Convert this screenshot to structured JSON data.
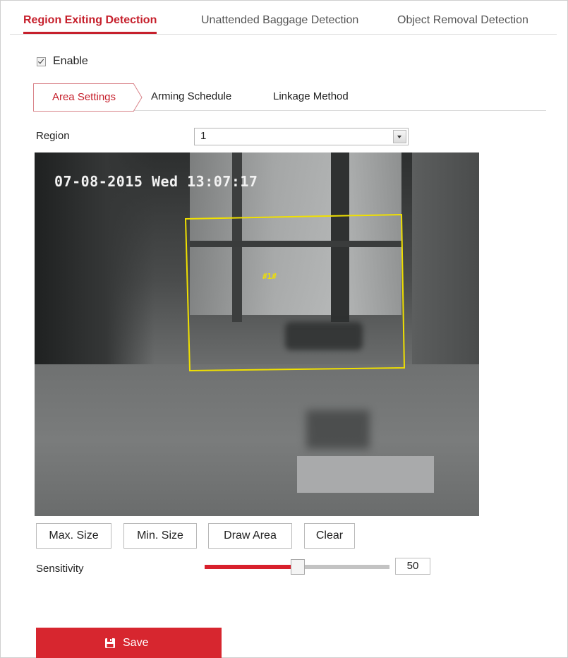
{
  "top_tabs": [
    "Region Exiting Detection",
    "Unattended Baggage Detection",
    "Object Removal Detection"
  ],
  "enable": {
    "label": "Enable",
    "checked": true
  },
  "sub_tabs": [
    "Area Settings",
    "Arming Schedule",
    "Linkage Method"
  ],
  "region": {
    "label": "Region",
    "value": "1"
  },
  "video": {
    "osd_datetime": "07-08-2015 Wed 13:07:17",
    "region_label": "#1#"
  },
  "buttons": {
    "max_size": "Max. Size",
    "min_size": "Min. Size",
    "draw_area": "Draw Area",
    "clear": "Clear"
  },
  "sensitivity": {
    "label": "Sensitivity",
    "value": "50",
    "fraction": 0.5
  },
  "save": {
    "label": "Save"
  },
  "colors": {
    "accent": "#d7262f",
    "region_line": "#f0e000"
  }
}
